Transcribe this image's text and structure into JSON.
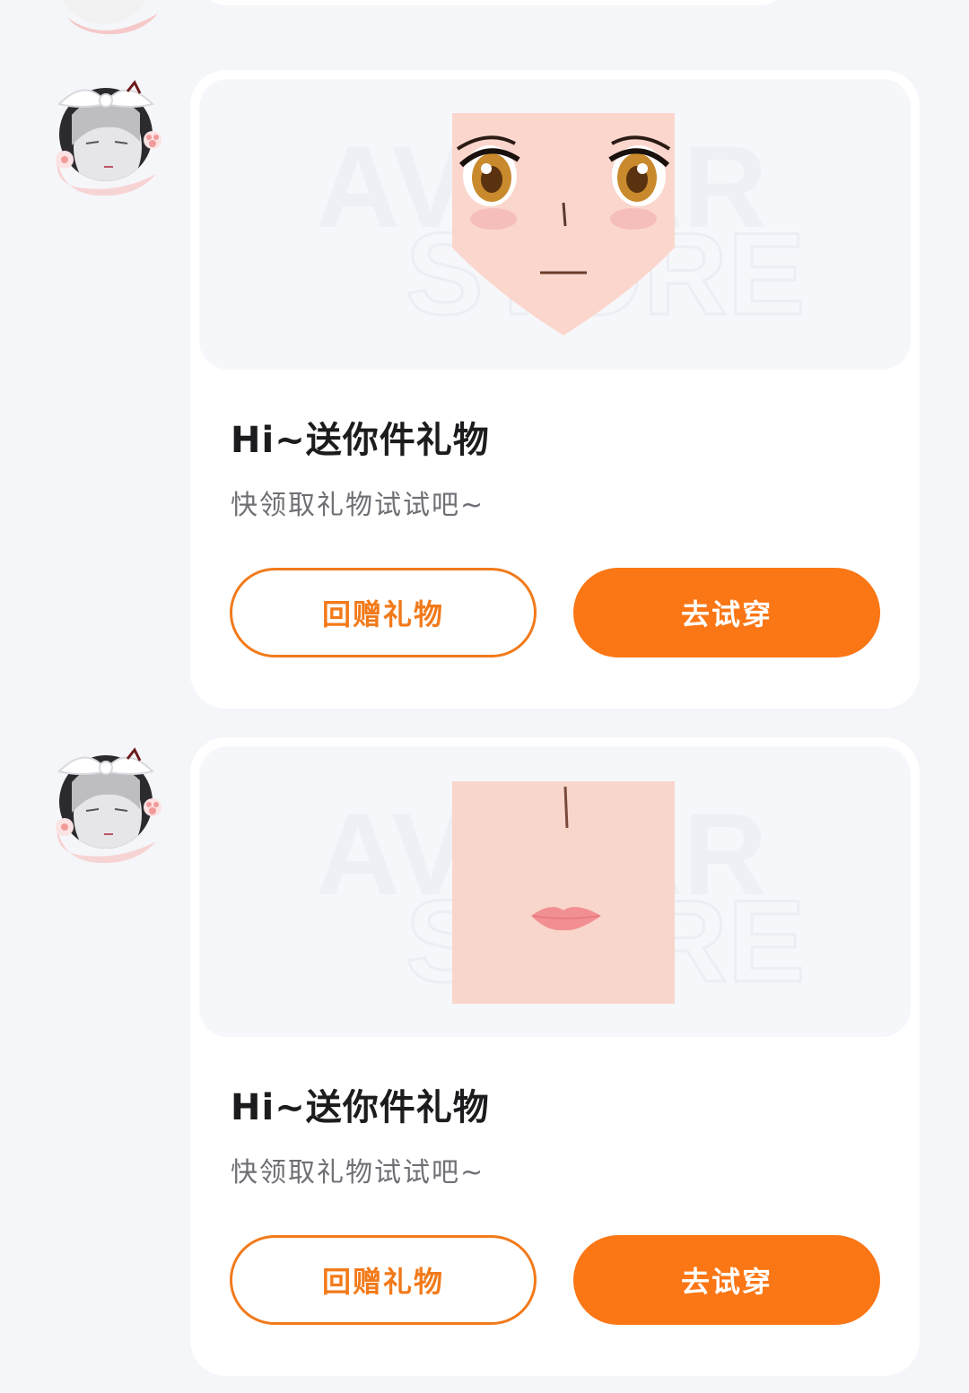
{
  "messages": [
    {
      "title": "Hi~送你件礼物",
      "subtitle": "快领取礼物试试吧~",
      "return_gift_label": "回赠礼物",
      "try_on_label": "去试穿",
      "gift_image": "anime-face-with-eyes-icon"
    },
    {
      "title": "Hi~送你件礼物",
      "subtitle": "快领取礼物试试吧~",
      "return_gift_label": "回赠礼物",
      "try_on_label": "去试穿",
      "gift_image": "nose-and-lips-skin-icon"
    }
  ],
  "watermark": [
    "AVATAR",
    "STORE"
  ],
  "colors": {
    "accent": "#fb7614",
    "outline": "#f27a1a",
    "background": "#f5f6f9",
    "card": "#ffffff"
  }
}
